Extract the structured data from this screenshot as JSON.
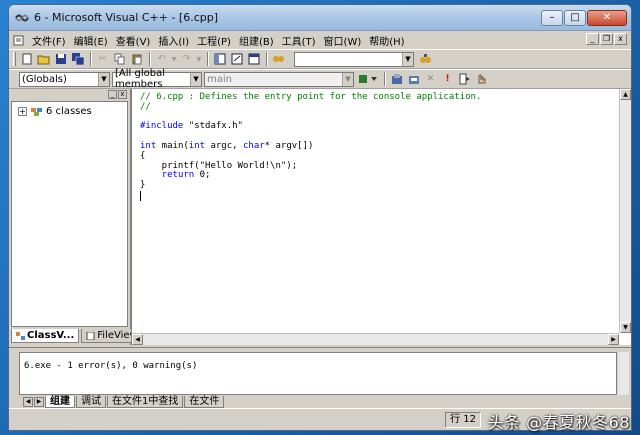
{
  "window": {
    "title": "6 - Microsoft Visual C++ - [6.cpp]"
  },
  "window_controls": {
    "minimize": "–",
    "maximize": "□",
    "close": "✕"
  },
  "mdi_controls": {
    "minimize": "_",
    "restore": "❐",
    "close": "x"
  },
  "menu": [
    "文件(F)",
    "编辑(E)",
    "查看(V)",
    "插入(I)",
    "工程(P)",
    "组建(B)",
    "工具(T)",
    "窗口(W)",
    "帮助(H)"
  ],
  "wizard_bar": {
    "scope": "(Globals)",
    "members": "[All global members",
    "function": "main"
  },
  "workspace": {
    "tree_item": "6 classes",
    "tabs": [
      "ClassV...",
      "FileView"
    ],
    "close_glyphs": {
      "restore": "_",
      "close": "x"
    }
  },
  "code_lines": [
    {
      "tokens": [
        {
          "t": "// 6.cpp : Defines the entry point for the console application.",
          "c": "cmt"
        }
      ]
    },
    {
      "tokens": [
        {
          "t": "//",
          "c": "cmt"
        }
      ]
    },
    {
      "tokens": []
    },
    {
      "tokens": [
        {
          "t": "#include",
          "c": "kw"
        },
        {
          "t": " \"stdafx.h\"",
          "c": ""
        }
      ]
    },
    {
      "tokens": []
    },
    {
      "tokens": [
        {
          "t": "int",
          "c": "kw"
        },
        {
          "t": " main(",
          "c": ""
        },
        {
          "t": "int",
          "c": "kw"
        },
        {
          "t": " argc, ",
          "c": ""
        },
        {
          "t": "char",
          "c": "kw"
        },
        {
          "t": "* argv[])",
          "c": ""
        }
      ]
    },
    {
      "tokens": [
        {
          "t": "{",
          "c": ""
        }
      ]
    },
    {
      "tokens": [
        {
          "t": "    printf(\"Hello World!\\n\");",
          "c": ""
        }
      ]
    },
    {
      "tokens": [
        {
          "t": "    ",
          "c": ""
        },
        {
          "t": "return",
          "c": "kw"
        },
        {
          "t": " 0;",
          "c": ""
        }
      ]
    },
    {
      "tokens": [
        {
          "t": "}",
          "c": ""
        }
      ]
    },
    {
      "tokens": []
    }
  ],
  "output": {
    "message": "6.exe - 1 error(s), 0 warning(s)",
    "tabs": [
      "组建",
      "调试",
      "在文件1中查找",
      "在文件"
    ]
  },
  "status": {
    "cell": "行 12"
  },
  "watermark": "头条 @春夏秋冬68",
  "colors": {
    "comment": "#008000",
    "keyword": "#0000ff",
    "titlebar": "#a9c6e6"
  }
}
